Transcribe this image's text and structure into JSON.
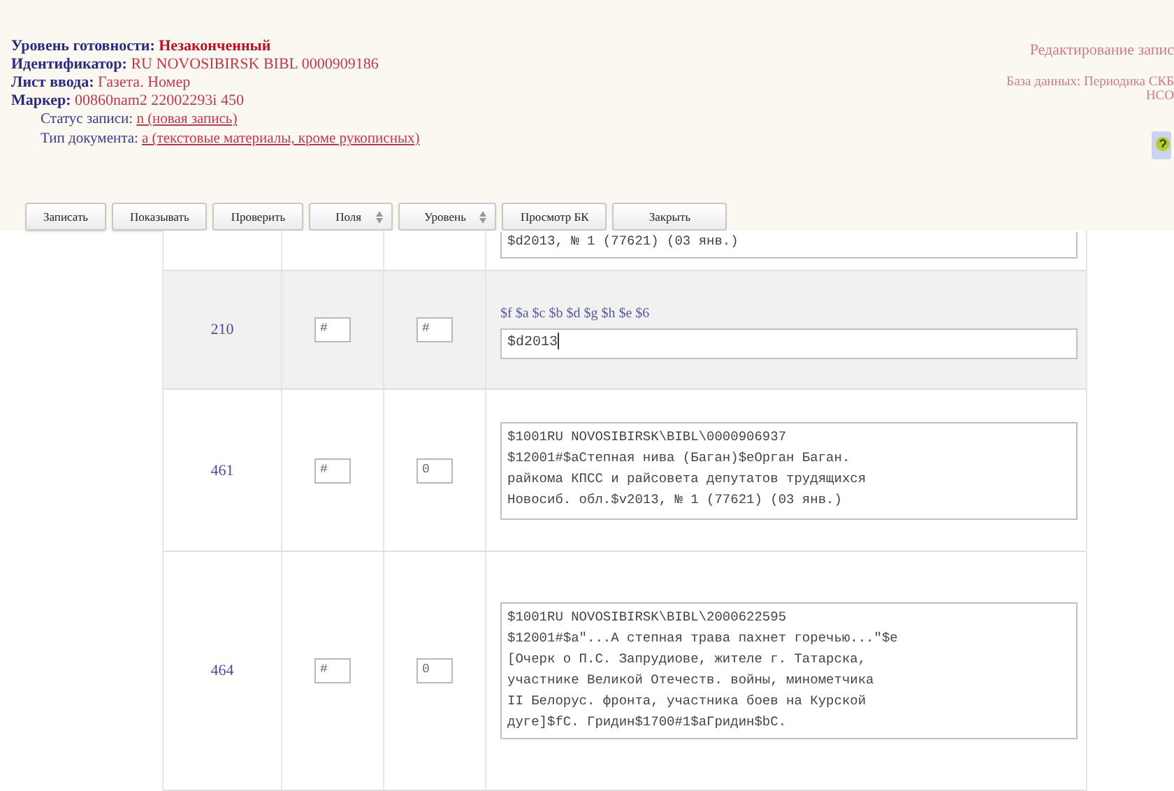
{
  "header": {
    "fields": [
      {
        "label": "Уровень готовности:",
        "value": "Незаконченный",
        "kind": "strong"
      },
      {
        "label": "Идентификатор:",
        "value": "RU NOVOSIBIRSK BIBL 0000909186",
        "kind": "plain"
      },
      {
        "label": "Лист ввода:",
        "value": "Газета. Номер",
        "kind": "plain"
      },
      {
        "label": "Маркер:",
        "value": "00860nam2 22002293i 450",
        "kind": "plain"
      },
      {
        "label": "Статус записи:",
        "value": "n (новая запись)",
        "kind": "link"
      },
      {
        "label": "Тип документа:",
        "value": "a (текстовые материалы, кроме рукописных)",
        "kind": "link"
      }
    ],
    "mode": "Редактирование запис",
    "database": "База данных: Периодика СКБ",
    "database_2": "НСО"
  },
  "toolbar": [
    {
      "label": "Записать",
      "kind": "button"
    },
    {
      "label": "Показывать",
      "kind": "button"
    },
    {
      "label": "Проверить",
      "kind": "button"
    },
    {
      "label": "Поля",
      "kind": "dropdown"
    },
    {
      "label": "Уровень",
      "kind": "dropdown"
    },
    {
      "label": "Просмотр БК",
      "kind": "button"
    },
    {
      "label": "Закрыть",
      "kind": "button"
    }
  ],
  "rows": [
    {
      "tag": "",
      "ind1": "",
      "ind2": "",
      "hint": "",
      "value": "$d2013, № 1 (77621) (03 янв.)",
      "kind": "cut",
      "selected": false
    },
    {
      "tag": "210",
      "ind1": "#",
      "ind2": "#",
      "hint": "$f $a $c $b $d $g $h $e $6",
      "value": "$d2013",
      "kind": "line",
      "selected": true
    },
    {
      "tag": "461",
      "ind1": "#",
      "ind2": "0",
      "hint": "",
      "value": "$1001RU NOVOSIBIRSK\\BIBL\\0000906937\n$12001#$aСтепная нива (Баган)$eОрган Баган.\nрайкома КПСС и райсовета депутатов трудящихся\nНовосиб. обл.$v2013, № 1 (77621) (03 янв.)",
      "kind": "area",
      "selected": false
    },
    {
      "tag": "464",
      "ind1": "#",
      "ind2": "0",
      "hint": "",
      "value": "$1001RU NOVOSIBIRSK\\BIBL\\2000622595\n$12001#$a\"...А степная трава пахнет горечью...\"$e\n[Очерк о П.С. Запрудиове, жителе г. Татарска,\nучастнике Великой Отечеств. войны, минометчика\nII Белорус. фронта, участника боев на Курской\nдуге]$fС. Гридин$1700#1$aГридин$bС.",
      "kind": "area",
      "selected": false
    }
  ]
}
